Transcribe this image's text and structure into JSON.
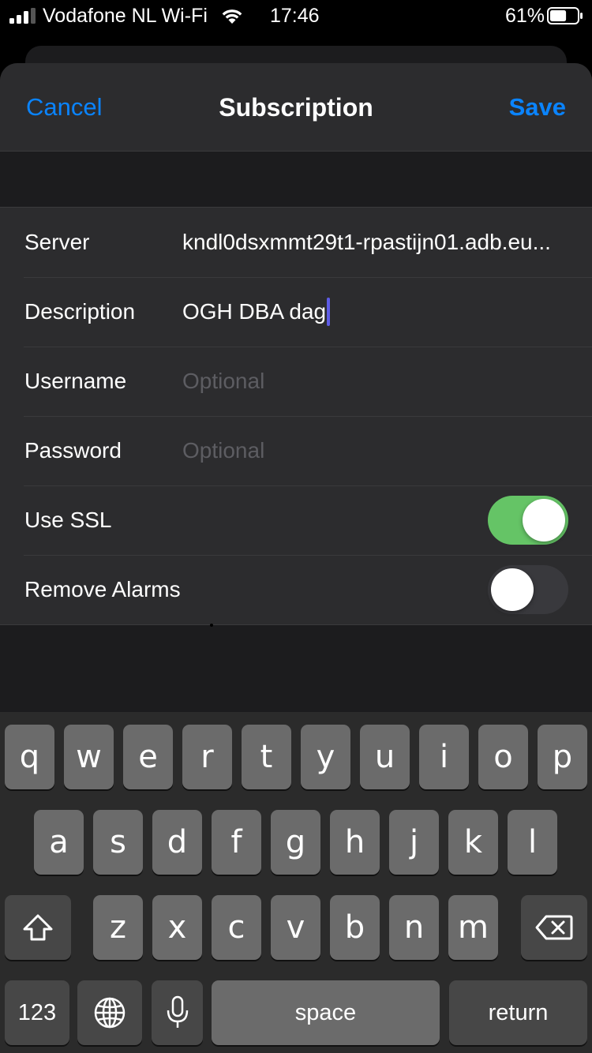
{
  "status_bar": {
    "carrier": "Vodafone NL Wi-Fi",
    "time": "17:46",
    "battery_percent": "61%",
    "battery_level": 0.61,
    "signal_bars": 3
  },
  "navbar": {
    "cancel_label": "Cancel",
    "title": "Subscription",
    "save_label": "Save"
  },
  "form": {
    "server": {
      "label": "Server",
      "value": "kndl0dsxmmt29t1-rpastijn01.adb.eu..."
    },
    "description": {
      "label": "Description",
      "value": "OGH DBA dag"
    },
    "username": {
      "label": "Username",
      "placeholder": "Optional"
    },
    "password": {
      "label": "Password",
      "placeholder": "Optional"
    },
    "use_ssl": {
      "label": "Use SSL",
      "on": true
    },
    "remove_alarms": {
      "label": "Remove Alarms",
      "on": false
    }
  },
  "keyboard": {
    "row1": [
      "q",
      "w",
      "e",
      "r",
      "t",
      "y",
      "u",
      "i",
      "o",
      "p"
    ],
    "row2": [
      "a",
      "s",
      "d",
      "f",
      "g",
      "h",
      "j",
      "k",
      "l"
    ],
    "row3": [
      "z",
      "x",
      "c",
      "v",
      "b",
      "n",
      "m"
    ],
    "numbers_label": "123",
    "space_label": "space",
    "return_label": "return"
  },
  "colors": {
    "accent": "#0a84ff",
    "toggle_on": "#65c466",
    "caret": "#5e5ce6"
  }
}
